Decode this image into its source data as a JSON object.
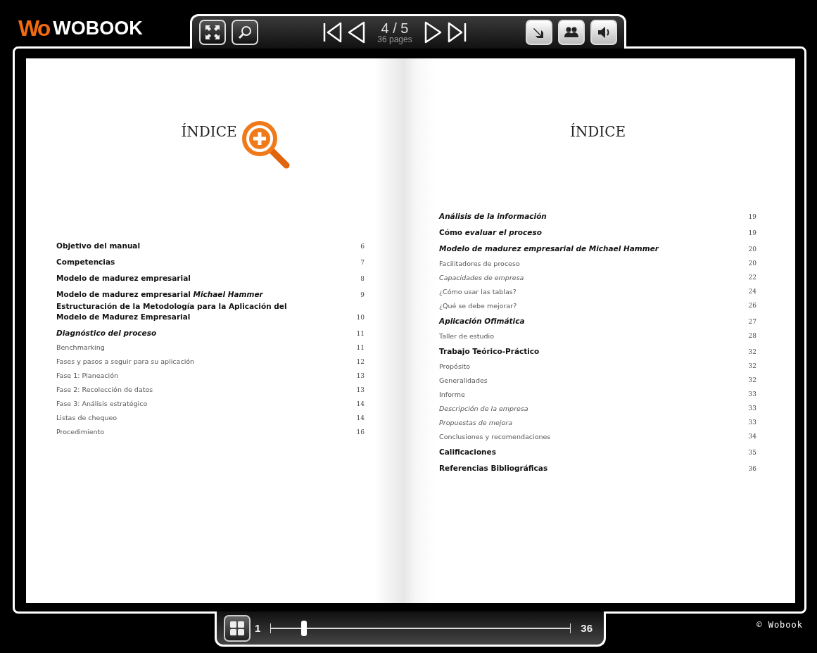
{
  "header": {
    "logo_mark": "Wo",
    "logo_text": "WOBOOK"
  },
  "toolbar": {
    "page_indicator": "4 / 5",
    "page_count": "36 pages"
  },
  "pages": [
    {
      "title": "ÍNDICE",
      "zoom_hint": true,
      "entries": [
        {
          "text": "Objetivo del manual",
          "page": "6",
          "kind": "main"
        },
        {
          "text": "Competencias",
          "page": "7",
          "kind": "main"
        },
        {
          "text": "Modelo de madurez empresarial",
          "page": "8",
          "kind": "main"
        },
        {
          "text": "Modelo de madurez empresarial *Michael Hammer*",
          "page": "9",
          "kind": "main"
        },
        {
          "text": "Estructuración de la Metodología para la Aplicación del Modelo de Madurez Empresarial",
          "page": "10",
          "kind": "main"
        },
        {
          "text": "Diagnóstico del proceso",
          "page": "11",
          "kind": "main-italic"
        },
        {
          "text": "Benchmarking",
          "page": "11",
          "kind": "sub"
        },
        {
          "text": "Fases y pasos a seguir para su aplicación",
          "page": "12",
          "kind": "sub"
        },
        {
          "text": "Fase 1: Planeación",
          "page": "13",
          "kind": "sub"
        },
        {
          "text": "Fase 2: Recolección de datos",
          "page": "13",
          "kind": "sub"
        },
        {
          "text": "Fase 3: Análisis estratégico",
          "page": "14",
          "kind": "sub"
        },
        {
          "text": "Listas de chequeo",
          "page": "14",
          "kind": "sub"
        },
        {
          "text": "Procedimiento",
          "page": "16",
          "kind": "sub"
        }
      ]
    },
    {
      "title": "ÍNDICE",
      "zoom_hint": false,
      "entries": [
        {
          "text": "Análisis de la información",
          "page": "19",
          "kind": "main-italic"
        },
        {
          "text": "Cómo *evaluar el proceso*",
          "page": "19",
          "kind": "main"
        },
        {
          "text": "Modelo de madurez empresarial de Michael Hammer",
          "page": "20",
          "kind": "main-italic"
        },
        {
          "text": "Facilitadores de proceso",
          "page": "20",
          "kind": "sub"
        },
        {
          "text": "Capacidades de empresa",
          "page": "22",
          "kind": "sub-italic"
        },
        {
          "text": "¿Cómo usar las tablas?",
          "page": "24",
          "kind": "sub"
        },
        {
          "text": "¿Qué se debe mejorar?",
          "page": "26",
          "kind": "sub"
        },
        {
          "text": "Aplicación Ofimática",
          "page": "27",
          "kind": "main-italic"
        },
        {
          "text": "Taller de estudio",
          "page": "28",
          "kind": "sub"
        },
        {
          "text": "Trabajo Teórico-Práctico",
          "page": "32",
          "kind": "main"
        },
        {
          "text": "Propósito",
          "page": "32",
          "kind": "sub"
        },
        {
          "text": "Generalidades",
          "page": "32",
          "kind": "sub"
        },
        {
          "text": "Informe",
          "page": "33",
          "kind": "sub"
        },
        {
          "text": "Descripción de la empresa",
          "page": "33",
          "kind": "sub-italic"
        },
        {
          "text": "Propuestas de mejora",
          "page": "33",
          "kind": "sub-italic"
        },
        {
          "text": "Conclusiones y recomendaciones",
          "page": "34",
          "kind": "sub"
        },
        {
          "text": "Calificaciones",
          "page": "35",
          "kind": "main"
        },
        {
          "text": "Referencias Bibliográficas",
          "page": "36",
          "kind": "main"
        }
      ]
    }
  ],
  "slider": {
    "min_label": "1",
    "max_label": "36",
    "level": 0.11
  },
  "copyright": "© Wobook"
}
